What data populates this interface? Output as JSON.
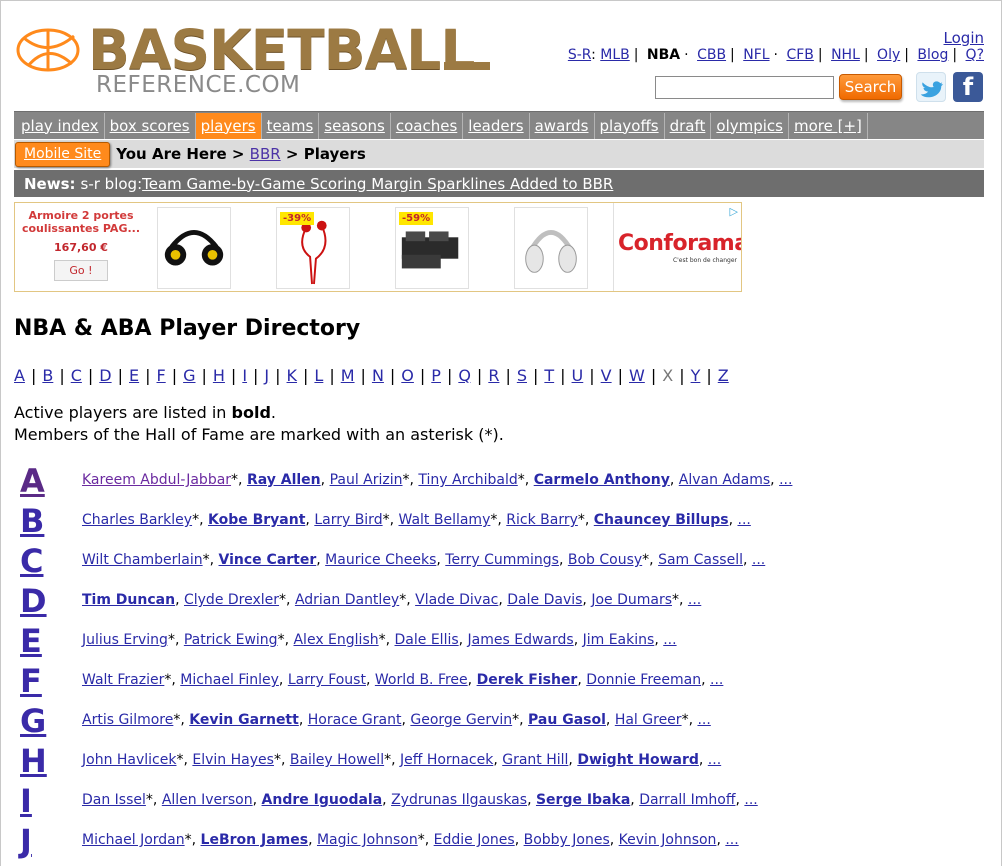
{
  "brand": {
    "name": "BASKETBALL",
    "sub": "REFERENCE.COM"
  },
  "header": {
    "login": "Login",
    "sitenav": [
      {
        "label": "S-R",
        "link": true,
        "suffix": ":"
      },
      {
        "label": "MLB",
        "link": true
      },
      {
        "label": "NBA",
        "link": false,
        "current": true
      },
      {
        "label": "CBB",
        "link": true
      },
      {
        "label": "NFL",
        "link": true
      },
      {
        "label": "CFB",
        "link": true
      },
      {
        "label": "NHL",
        "link": true
      },
      {
        "label": "Oly",
        "link": true
      },
      {
        "label": "Blog",
        "link": true
      },
      {
        "label": "Q?",
        "link": true
      }
    ],
    "search_value": "",
    "search_button": "Search",
    "facebook_glyph": "f"
  },
  "mainnav": [
    "play index",
    "box scores",
    "players",
    "teams",
    "seasons",
    "coaches",
    "leaders",
    "awards",
    "playoffs",
    "draft",
    "olympics",
    "more [+]"
  ],
  "mainnav_active": "players",
  "crumbbar": {
    "mobile": "Mobile Site",
    "prefix": "You Are Here",
    "bbr": "BBR",
    "current": "Players"
  },
  "news": {
    "label": "News:",
    "source": "s-r blog:",
    "headline": "Team Game-by-Game Scoring Margin Sparklines Added to BBR"
  },
  "ad": {
    "first_title": "Armoire 2 portes coulissantes PAG...",
    "first_price": "167,60 €",
    "first_cta": "Go !",
    "badges": [
      "-39%",
      "-59%"
    ],
    "brand": "Conforama",
    "slogan": "C'est bon de changer",
    "adchoice_icon": "adchoices-icon",
    "product_icons": [
      "headphones-sport-icon",
      "earphones-red-icon",
      "sofa-icon",
      "headphones-white-icon"
    ]
  },
  "page": {
    "title": "NBA & ABA Player Directory",
    "letters": [
      "A",
      "B",
      "C",
      "D",
      "E",
      "F",
      "G",
      "H",
      "I",
      "J",
      "K",
      "L",
      "M",
      "N",
      "O",
      "P",
      "Q",
      "R",
      "S",
      "T",
      "U",
      "V",
      "W",
      "X",
      "Y",
      "Z"
    ],
    "disabled_letters": [
      "X"
    ],
    "note1_prefix": "Active players are listed in ",
    "note1_bold": "bold",
    "note1_suffix": ".",
    "note2": "Members of the Hall of Fame are marked with an asterisk (*)."
  },
  "directory": [
    {
      "letter": "A",
      "players": [
        {
          "name": "Kareem Abdul-Jabbar",
          "hof": true,
          "visited": true
        },
        {
          "name": "Ray Allen",
          "bold": true
        },
        {
          "name": "Paul Arizin",
          "hof": true
        },
        {
          "name": "Tiny Archibald",
          "hof": true
        },
        {
          "name": "Carmelo Anthony",
          "bold": true
        },
        {
          "name": "Alvan Adams"
        }
      ]
    },
    {
      "letter": "B",
      "players": [
        {
          "name": "Charles Barkley",
          "hof": true
        },
        {
          "name": "Kobe Bryant",
          "bold": true
        },
        {
          "name": "Larry Bird",
          "hof": true
        },
        {
          "name": "Walt Bellamy",
          "hof": true
        },
        {
          "name": "Rick Barry",
          "hof": true
        },
        {
          "name": "Chauncey Billups",
          "bold": true
        }
      ]
    },
    {
      "letter": "C",
      "players": [
        {
          "name": "Wilt Chamberlain",
          "hof": true
        },
        {
          "name": "Vince Carter",
          "bold": true
        },
        {
          "name": "Maurice Cheeks"
        },
        {
          "name": "Terry Cummings"
        },
        {
          "name": "Bob Cousy",
          "hof": true
        },
        {
          "name": "Sam Cassell"
        }
      ]
    },
    {
      "letter": "D",
      "players": [
        {
          "name": "Tim Duncan",
          "bold": true
        },
        {
          "name": "Clyde Drexler",
          "hof": true
        },
        {
          "name": "Adrian Dantley",
          "hof": true
        },
        {
          "name": "Vlade Divac"
        },
        {
          "name": "Dale Davis"
        },
        {
          "name": "Joe Dumars",
          "hof": true
        }
      ]
    },
    {
      "letter": "E",
      "players": [
        {
          "name": "Julius Erving",
          "hof": true
        },
        {
          "name": "Patrick Ewing",
          "hof": true
        },
        {
          "name": "Alex English",
          "hof": true
        },
        {
          "name": "Dale Ellis"
        },
        {
          "name": "James Edwards"
        },
        {
          "name": "Jim Eakins"
        }
      ]
    },
    {
      "letter": "F",
      "players": [
        {
          "name": "Walt Frazier",
          "hof": true
        },
        {
          "name": "Michael Finley"
        },
        {
          "name": "Larry Foust"
        },
        {
          "name": "World B. Free"
        },
        {
          "name": "Derek Fisher",
          "bold": true
        },
        {
          "name": "Donnie Freeman"
        }
      ]
    },
    {
      "letter": "G",
      "players": [
        {
          "name": "Artis Gilmore",
          "hof": true
        },
        {
          "name": "Kevin Garnett",
          "bold": true
        },
        {
          "name": "Horace Grant"
        },
        {
          "name": "George Gervin",
          "hof": true
        },
        {
          "name": "Pau Gasol",
          "bold": true
        },
        {
          "name": "Hal Greer",
          "hof": true
        }
      ]
    },
    {
      "letter": "H",
      "players": [
        {
          "name": "John Havlicek",
          "hof": true
        },
        {
          "name": "Elvin Hayes",
          "hof": true
        },
        {
          "name": "Bailey Howell",
          "hof": true
        },
        {
          "name": "Jeff Hornacek"
        },
        {
          "name": "Grant Hill"
        },
        {
          "name": "Dwight Howard",
          "bold": true
        }
      ]
    },
    {
      "letter": "I",
      "players": [
        {
          "name": "Dan Issel",
          "hof": true
        },
        {
          "name": "Allen Iverson"
        },
        {
          "name": "Andre Iguodala",
          "bold": true
        },
        {
          "name": "Zydrunas Ilgauskas"
        },
        {
          "name": "Serge Ibaka",
          "bold": true
        },
        {
          "name": "Darrall Imhoff"
        }
      ]
    },
    {
      "letter": "J",
      "players": [
        {
          "name": "Michael Jordan",
          "hof": true
        },
        {
          "name": "LeBron James",
          "bold": true
        },
        {
          "name": "Magic Johnson",
          "hof": true
        },
        {
          "name": "Eddie Jones"
        },
        {
          "name": "Bobby Jones"
        },
        {
          "name": "Kevin Johnson"
        }
      ]
    }
  ],
  "more_link": "...",
  "colors": {
    "accent": "#ff8a1c",
    "nav": "#868686",
    "news": "#6e6e6e",
    "link": "#2a2aa8",
    "gold": "#9c7a43"
  }
}
